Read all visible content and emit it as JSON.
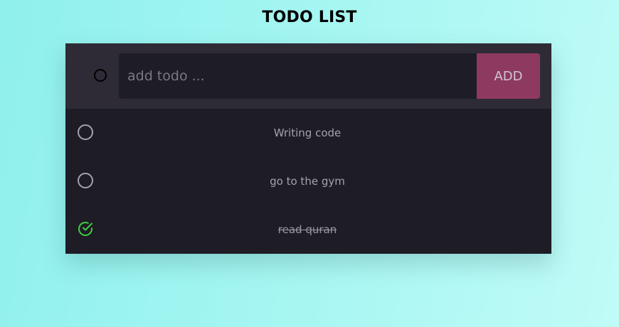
{
  "header": {
    "title": "TODO LIST"
  },
  "composer": {
    "placeholder": "add todo ...",
    "value": "",
    "add_label": "ADD"
  },
  "todos": [
    {
      "text": "Writing code",
      "completed": false,
      "icon": "circle-icon"
    },
    {
      "text": "go to the gym",
      "completed": false,
      "icon": "circle-icon"
    },
    {
      "text": "read quran",
      "completed": true,
      "icon": "check-circle-icon"
    }
  ],
  "colors": {
    "accent": "#8e3a60",
    "done_check": "#3ecf3e",
    "card_bg": "#1e1c25",
    "header_bg": "#2e2b37"
  }
}
